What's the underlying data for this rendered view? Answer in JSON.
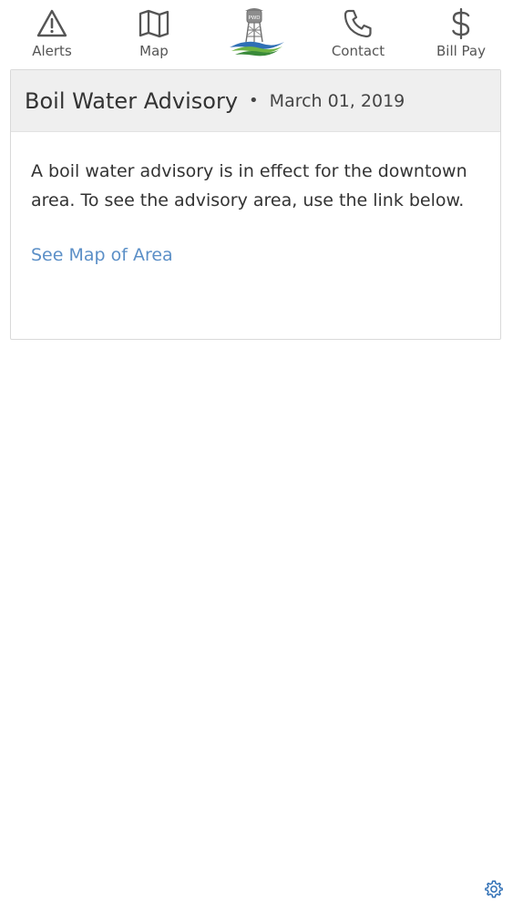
{
  "nav": {
    "alerts": {
      "label": "Alerts",
      "icon": "alert-triangle-icon"
    },
    "map": {
      "label": "Map",
      "icon": "map-icon"
    },
    "logo": {
      "icon": "water-tower-logo",
      "mark_text": "PWD"
    },
    "contact": {
      "label": "Contact",
      "icon": "phone-icon"
    },
    "bill_pay": {
      "label": "Bill Pay",
      "icon": "dollar-icon"
    }
  },
  "advisory": {
    "title": "Boil Water Advisory",
    "separator": "•",
    "date": "March 01, 2019",
    "body": "A boil water advisory is in effect for the downtown area. To see the advisory area, use the link below.",
    "link_label": "See Map of Area"
  },
  "footer": {
    "settings_icon": "gear-icon"
  },
  "colors": {
    "link": "#5b8fc7",
    "header_bg": "#efefef",
    "text": "#333333",
    "icon": "#555555",
    "gear": "#2f6fb5"
  }
}
